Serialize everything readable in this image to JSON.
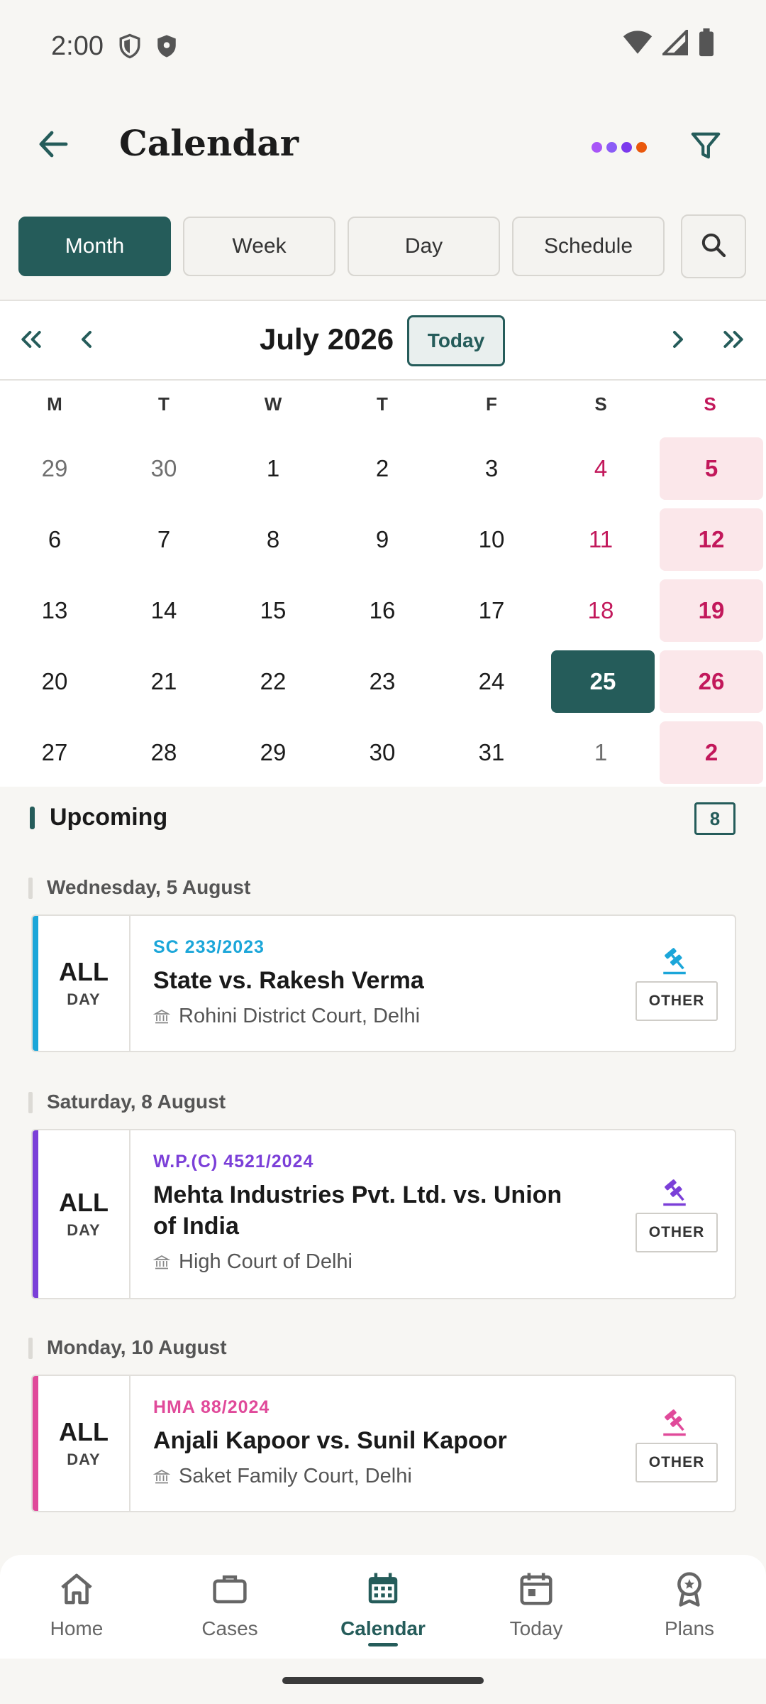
{
  "status_bar": {
    "time": "2:00"
  },
  "app_bar": {
    "title": "Calendar",
    "dot_colors": [
      "#a855f7",
      "#8b5cf6",
      "#7c3aed",
      "#ea580c"
    ]
  },
  "view_tabs": [
    {
      "label": "Month",
      "active": true
    },
    {
      "label": "Week",
      "active": false
    },
    {
      "label": "Day",
      "active": false
    },
    {
      "label": "Schedule",
      "active": false
    }
  ],
  "calendar": {
    "month_label": "July 2026",
    "today_label": "Today",
    "weekdays": [
      "M",
      "T",
      "W",
      "T",
      "F",
      "S",
      "S"
    ],
    "weeks": [
      [
        "29",
        "30",
        "1",
        "2",
        "3",
        "4",
        "5"
      ],
      [
        "6",
        "7",
        "8",
        "9",
        "10",
        "11",
        "12"
      ],
      [
        "13",
        "14",
        "15",
        "16",
        "17",
        "18",
        "19"
      ],
      [
        "20",
        "21",
        "22",
        "23",
        "24",
        "25",
        "26"
      ],
      [
        "27",
        "28",
        "29",
        "30",
        "31",
        "1",
        "2"
      ]
    ],
    "selected_day": "25"
  },
  "upcoming": {
    "title": "Upcoming",
    "count": "8",
    "groups": [
      {
        "date_label": "Wednesday, 5 August",
        "event": {
          "all_label": "ALL",
          "day_label": "DAY",
          "case_no": "SC 233/2023",
          "title": "State vs. Rakesh Verma",
          "court": "Rohini District Court, Delhi",
          "type": "OTHER",
          "accent": "#1ba6d9"
        }
      },
      {
        "date_label": "Saturday, 8 August",
        "event": {
          "all_label": "ALL",
          "day_label": "DAY",
          "case_no": "W.P.(C) 4521/2024",
          "title": "Mehta Industries Pvt. Ltd. vs. Union of India",
          "court": "High Court of Delhi",
          "type": "OTHER",
          "accent": "#7b3fd8"
        }
      },
      {
        "date_label": "Monday, 10 August",
        "event": {
          "all_label": "ALL",
          "day_label": "DAY",
          "case_no": "HMA 88/2024",
          "title": "Anjali Kapoor vs. Sunil Kapoor",
          "court": "Saket Family Court, Delhi",
          "type": "OTHER",
          "accent": "#e04a9a"
        }
      }
    ]
  },
  "bottom_nav": [
    {
      "label": "Home",
      "icon": "home-icon",
      "active": false
    },
    {
      "label": "Cases",
      "icon": "briefcase-icon",
      "active": false
    },
    {
      "label": "Calendar",
      "icon": "calendar-icon",
      "active": true
    },
    {
      "label": "Today",
      "icon": "today-icon",
      "active": false
    },
    {
      "label": "Plans",
      "icon": "award-icon",
      "active": false
    }
  ],
  "colors": {
    "primary": "#255c5a",
    "weekend": "#c2185b",
    "sunday_bg": "#fbe7ea"
  }
}
